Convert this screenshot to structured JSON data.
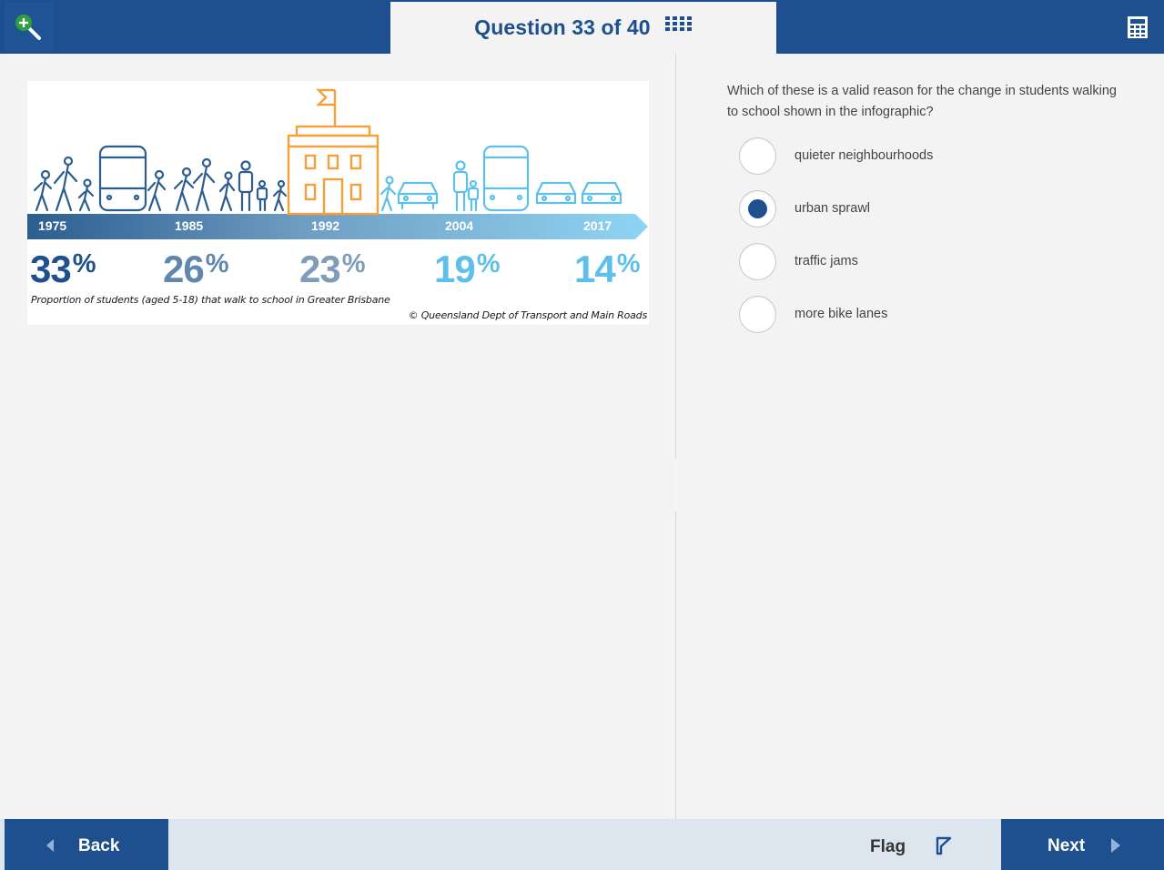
{
  "header": {
    "title": "Question 33 of 40",
    "icons": [
      "zoom-in-icon",
      "question-grid-icon",
      "calculator-icon"
    ]
  },
  "infographic": {
    "years": [
      "1975",
      "1985",
      "1992",
      "2004",
      "2017"
    ],
    "percents": [
      {
        "value": "33",
        "color": "#1e4f8f"
      },
      {
        "value": "26",
        "color": "#5f87b0"
      },
      {
        "value": "23",
        "color": "#7f9cba"
      },
      {
        "value": "19",
        "color": "#5cc0ea"
      },
      {
        "value": "14",
        "color": "#5cc0ea"
      }
    ],
    "percent_symbol": "%",
    "caption": "Proportion of students (aged 5-18) that walk to school in Greater Brisbane",
    "credit": "© Queensland Dept of Transport and Main Roads"
  },
  "question": {
    "text": "Which of these is a valid reason for the change in students walking to school shown in the infographic?",
    "options": [
      {
        "label": "quieter neighbourhoods",
        "selected": false
      },
      {
        "label": "urban sprawl",
        "selected": true
      },
      {
        "label": "traffic jams",
        "selected": false
      },
      {
        "label": "more bike lanes",
        "selected": false
      }
    ]
  },
  "footer": {
    "back": "Back",
    "flag": "Flag",
    "next": "Next"
  },
  "colors": {
    "primary": "#1e4f8f",
    "background": "#f3f3f3",
    "footer": "#dde6ef",
    "orange": "#f5a13a",
    "light_blue": "#5cc0ea"
  }
}
